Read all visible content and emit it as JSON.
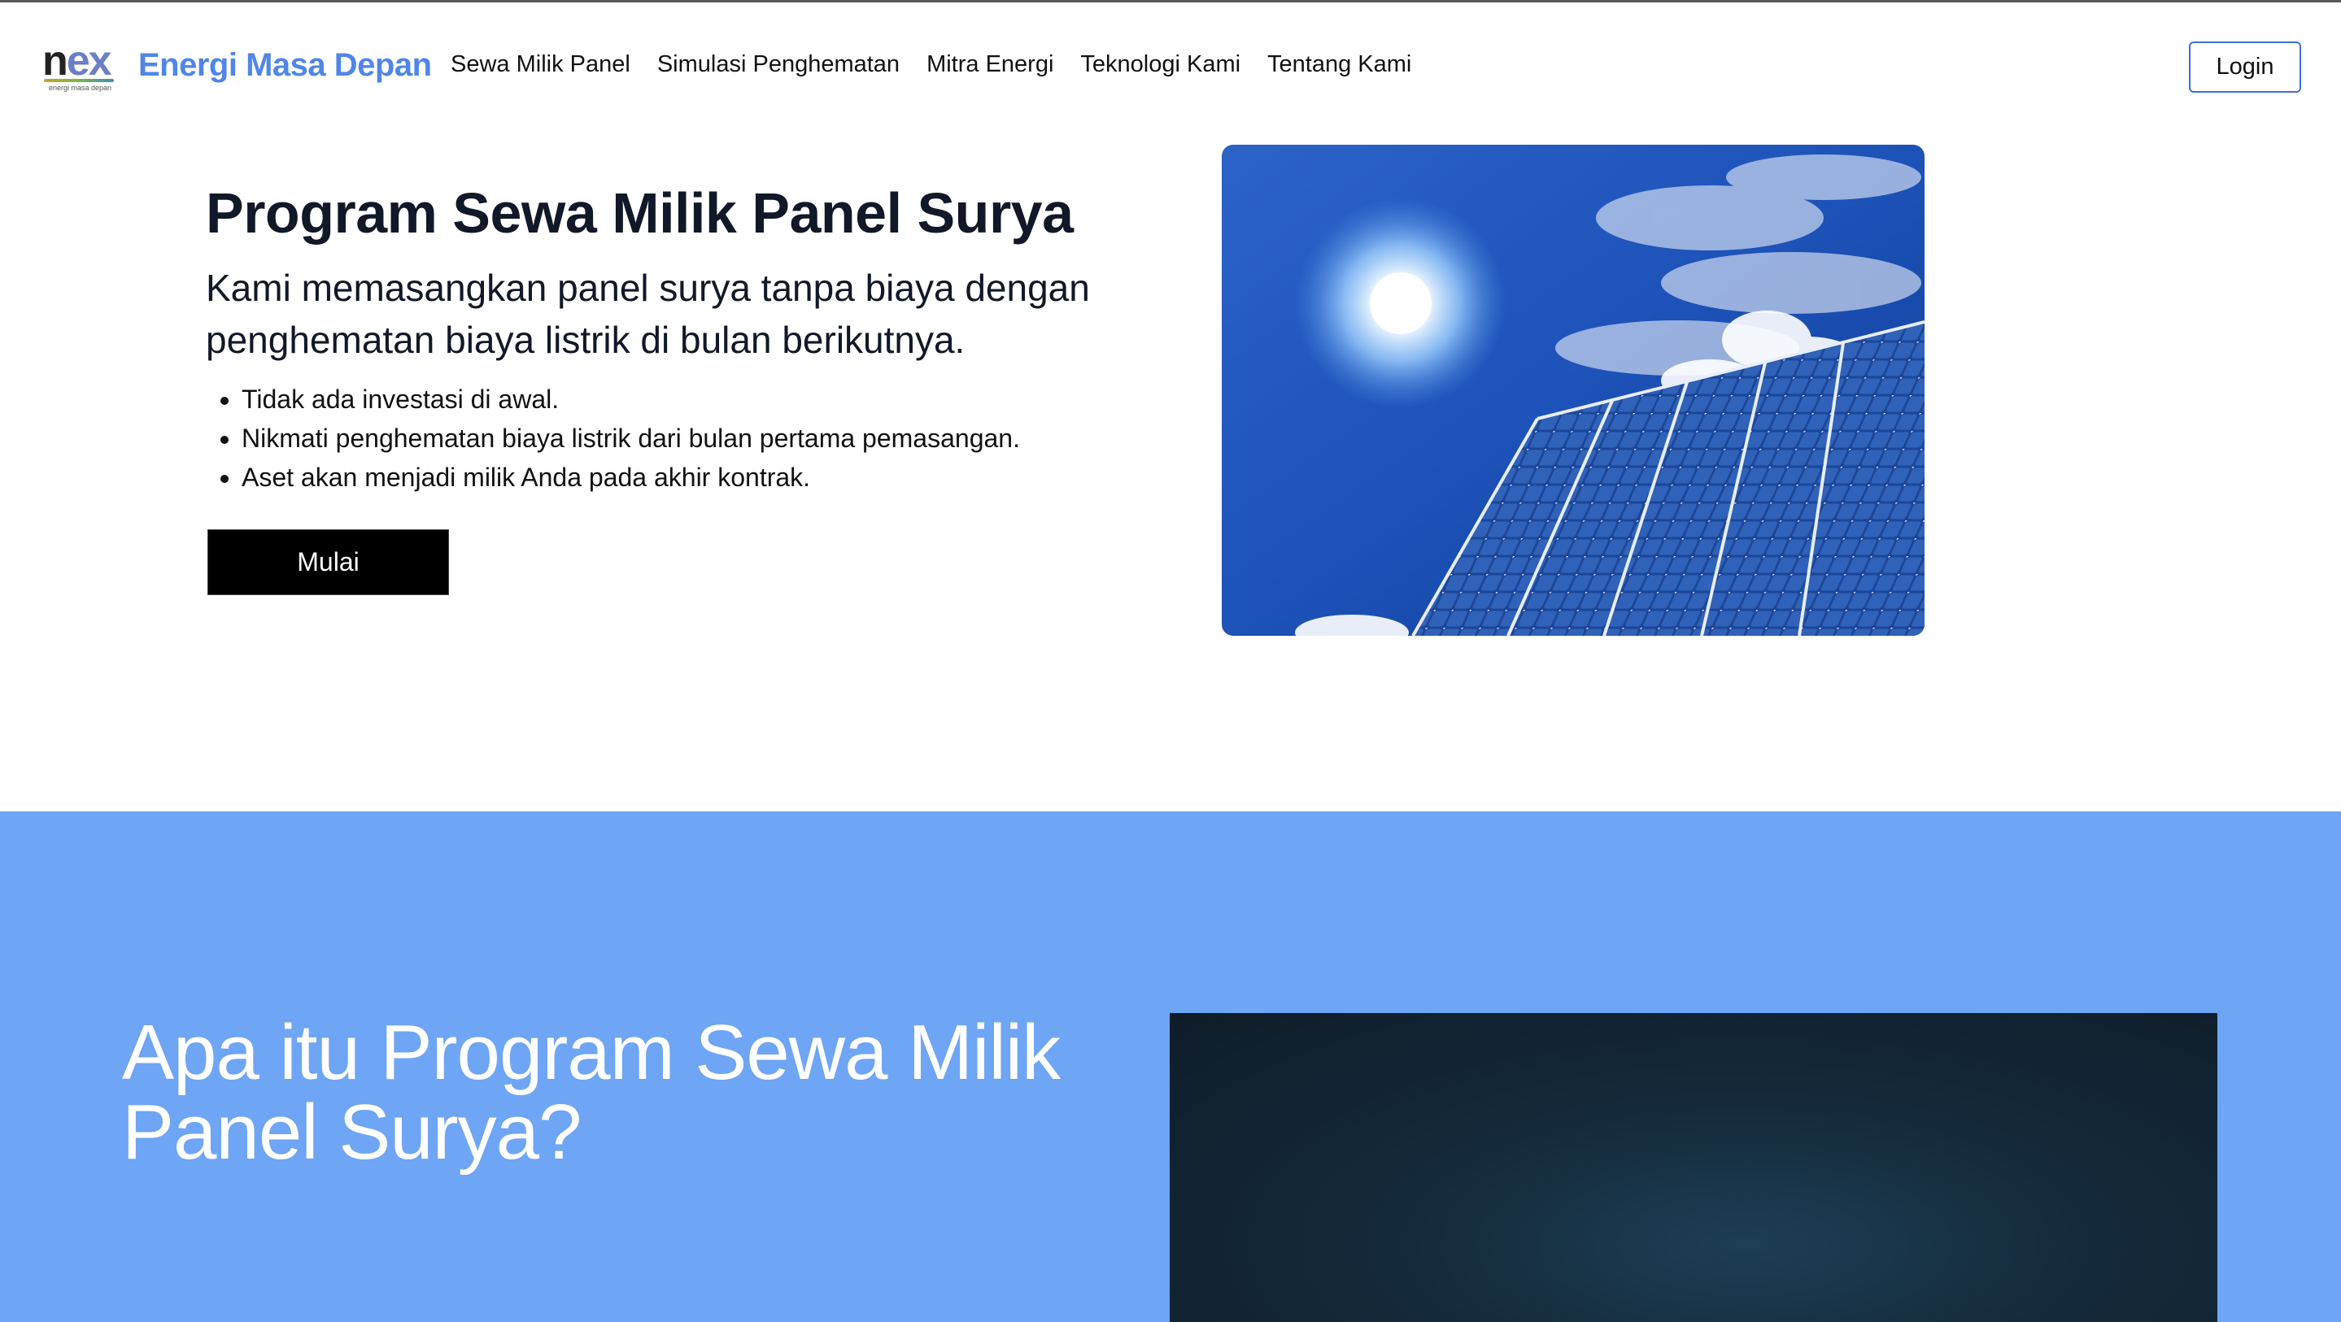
{
  "nav": {
    "logo_text_main": "n",
    "logo_text_accent": "ex",
    "logo_tagline": "energi masa depan",
    "brand": "Energi Masa Depan",
    "links": [
      "Sewa Milik Panel",
      "Simulasi Penghematan",
      "Mitra Energi",
      "Teknologi Kami",
      "Tentang Kami"
    ],
    "login": "Login"
  },
  "hero": {
    "title": "Program Sewa Milik Panel Surya",
    "subtitle": "Kami memasangkan panel surya tanpa biaya dengan penghematan biaya listrik di bulan berikutnya.",
    "bullets": [
      "Tidak ada investasi di awal.",
      "Nikmati penghematan biaya listrik dari bulan pertama pemasangan.",
      "Aset akan menjadi milik Anda pada akhir kontrak."
    ],
    "cta": "Mulai"
  },
  "section2": {
    "title": "Apa itu Program Sewa Milik Panel Surya?"
  },
  "colors": {
    "brand_blue": "#4f86e8",
    "section_blue": "#6ea5f5",
    "button_black": "#000000",
    "login_border": "#3b6fd8"
  }
}
